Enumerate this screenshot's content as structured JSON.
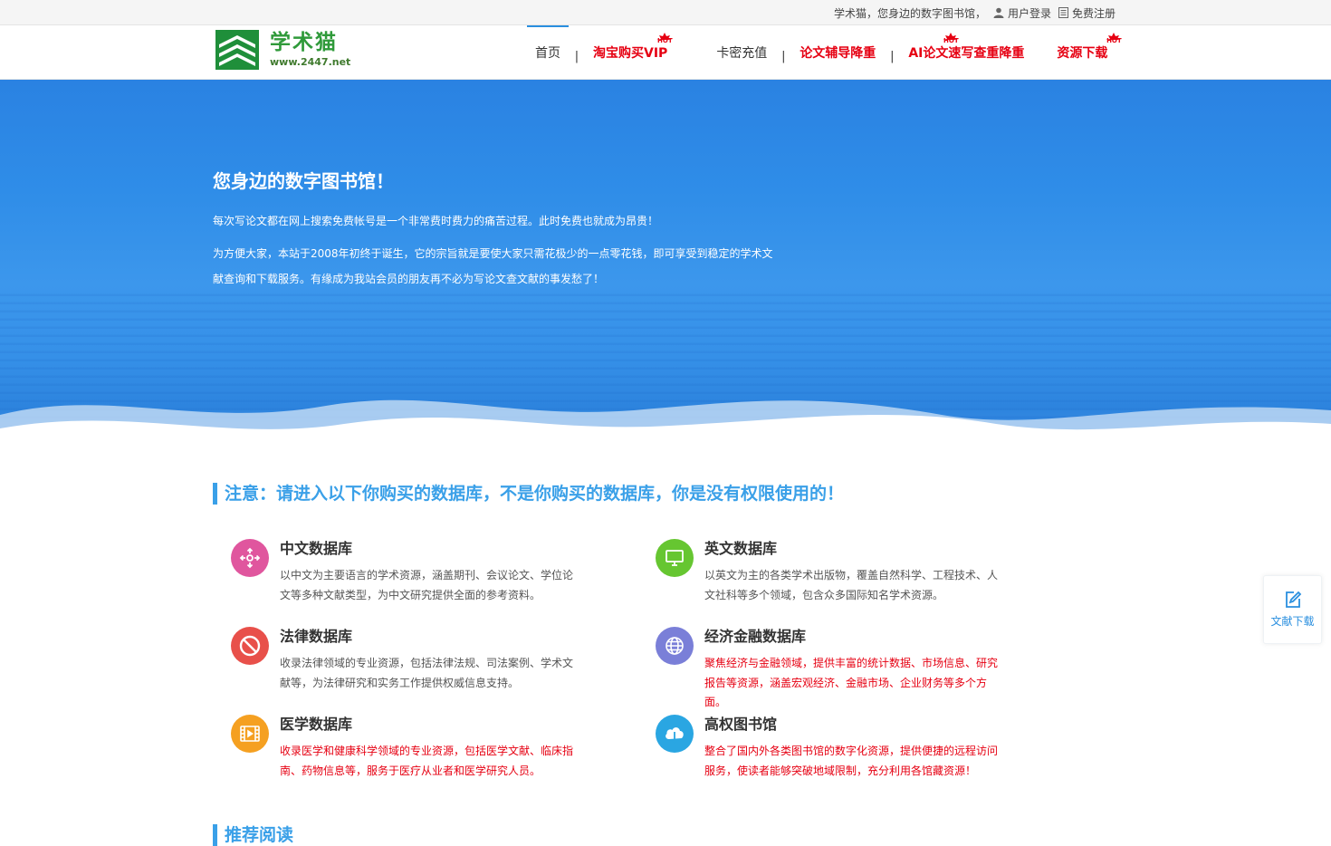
{
  "topbar": {
    "slogan": "学术猫，您身边的数字图书馆，",
    "login": "用户登录",
    "register": "免费注册"
  },
  "logo": {
    "title": "学术猫",
    "url": "www.2447.net"
  },
  "nav": {
    "items": [
      {
        "label": "首页",
        "hot": false
      },
      {
        "label": "淘宝购买VIP",
        "hot": true
      },
      {
        "label": "卡密充值",
        "hot": false
      },
      {
        "label": "论文辅导降重",
        "hot": false
      },
      {
        "label": "AI论文速写查重降重",
        "hot": true
      },
      {
        "label": "资源下载",
        "hot": true
      }
    ],
    "separator": "|",
    "hot_text": "HOT"
  },
  "banner": {
    "title": "您身边的数字图书馆！",
    "p1": "每次写论文都在网上搜索免费帐号是一个非常费时费力的痛苦过程。此时免费也就成为昂贵！",
    "p2": "为方便大家，本站于2008年初终于诞生，它的宗旨就是要使大家只需花极少的一点零花钱，即可享受到稳定的学术文献查询和下载服务。有缘成为我站会员的朋友再不必为写论文查文献的事发愁了！"
  },
  "notice": {
    "title": "注意：请进入以下你购买的数据库，不是你购买的数据库，你是没有权限使用的！"
  },
  "databases": [
    {
      "title": "中文数据库",
      "desc": "以中文为主要语言的学术资源，涵盖期刊、会议论文、学位论文等多种文献类型，为中文研究提供全面的参考资料。",
      "color": "#e0569e",
      "icon": "move-icon",
      "red": false
    },
    {
      "title": "英文数据库",
      "desc": "以英文为主的各类学术出版物，覆盖自然科学、工程技术、人文社科等多个领域，包含众多国际知名学术资源。",
      "color": "#66c631",
      "icon": "monitor-icon",
      "red": false
    },
    {
      "title": "法律数据库",
      "desc": "收录法律领域的专业资源，包括法律法规、司法案例、学术文献等，为法律研究和实务工作提供权威信息支持。",
      "color": "#e8504a",
      "icon": "ban-icon",
      "red": false
    },
    {
      "title": "经济金融数据库",
      "desc": "聚焦经济与金融领域，提供丰富的统计数据、市场信息、研究报告等资源，涵盖宏观经济、金融市场、企业财务等多个方面。",
      "color": "#7a7fd8",
      "icon": "globe-icon",
      "red": true
    },
    {
      "title": "医学数据库",
      "desc": "收录医学和健康科学领域的专业资源，包括医学文献、临床指南、药物信息等，服务于医疗从业者和医学研究人员。",
      "color": "#f5a021",
      "icon": "film-icon",
      "red": true
    },
    {
      "title": "高权图书馆",
      "desc": "整合了国内外各类图书馆的数字化资源，提供便捷的远程访问服务，使读者能够突破地域限制，充分利用各馆藏资源！",
      "color": "#2aa6e2",
      "icon": "cloud-icon",
      "red": true
    }
  ],
  "recommend": {
    "title": "推荐阅读"
  },
  "side_float": {
    "label": "文献下载"
  }
}
